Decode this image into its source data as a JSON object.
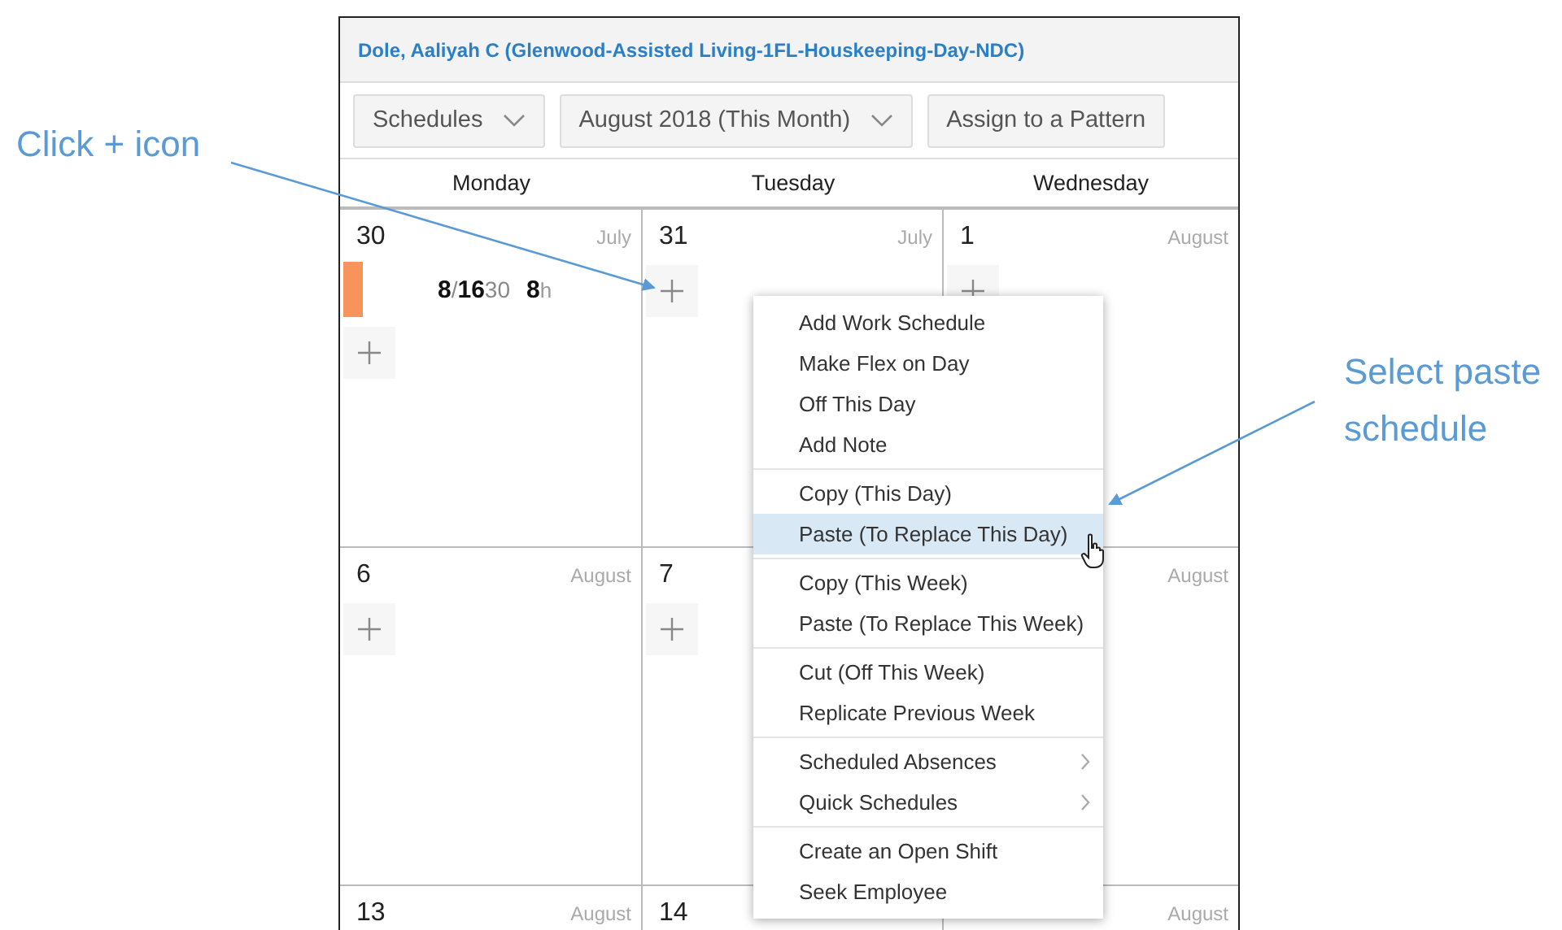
{
  "header": {
    "employee": "Dole, Aaliyah C (Glenwood-Assisted Living-1FL-Houskeeping-Day-NDC)"
  },
  "toolbar": [
    {
      "kind": "dropdown",
      "label": "Schedules"
    },
    {
      "kind": "dropdown",
      "label": "August 2018 (This Month)"
    },
    {
      "kind": "button",
      "label": "Assign to a Pattern"
    }
  ],
  "days": [
    "Monday",
    "Tuesday",
    "Wednesday"
  ],
  "weeks": [
    [
      {
        "day": "30",
        "month": "July",
        "add_button": true,
        "shifts": [
          {
            "time": "**8**/**16**30",
            "hours": "**8**h"
          }
        ]
      },
      {
        "day": "31",
        "month": "July",
        "add_button": true
      },
      {
        "day": "1",
        "month": "August",
        "add_button": true
      }
    ],
    [
      {
        "day": "6",
        "month": "August",
        "add_button": true
      },
      {
        "day": "7",
        "add_button": true
      },
      {
        "month": "August"
      }
    ],
    [
      {
        "day": "13",
        "month": "August"
      },
      {
        "day": "14"
      },
      {
        "month": "August"
      }
    ]
  ],
  "context_menu": [
    [
      {
        "label": "Add Work Schedule",
        "selected": false,
        "submenu": false
      },
      {
        "label": "Make Flex on Day",
        "selected": false,
        "submenu": false
      },
      {
        "label": "Off This Day",
        "selected": false,
        "submenu": false
      },
      {
        "label": "Add Note",
        "selected": false,
        "submenu": false
      }
    ],
    [
      {
        "label": "Copy (This Day)",
        "selected": false,
        "submenu": false
      },
      {
        "label": "Paste (To Replace This Day)",
        "selected": true,
        "submenu": false
      }
    ],
    [
      {
        "label": "Copy (This Week)",
        "selected": false,
        "submenu": false
      },
      {
        "label": "Paste (To Replace This Week)",
        "selected": false,
        "submenu": false
      }
    ],
    [
      {
        "label": "Cut (Off This Week)",
        "selected": false,
        "submenu": false
      },
      {
        "label": "Replicate Previous Week",
        "selected": false,
        "submenu": false
      }
    ],
    [
      {
        "label": "Scheduled Absences",
        "selected": false,
        "submenu": true
      },
      {
        "label": "Quick Schedules",
        "selected": false,
        "submenu": true
      }
    ],
    [
      {
        "label": "Create an Open Shift",
        "selected": false,
        "submenu": false
      },
      {
        "label": "Seek Employee",
        "selected": false,
        "submenu": false
      }
    ]
  ],
  "annotations": [
    {
      "text": "Click + icon"
    },
    {
      "text": "Select paste schedule"
    }
  ]
}
